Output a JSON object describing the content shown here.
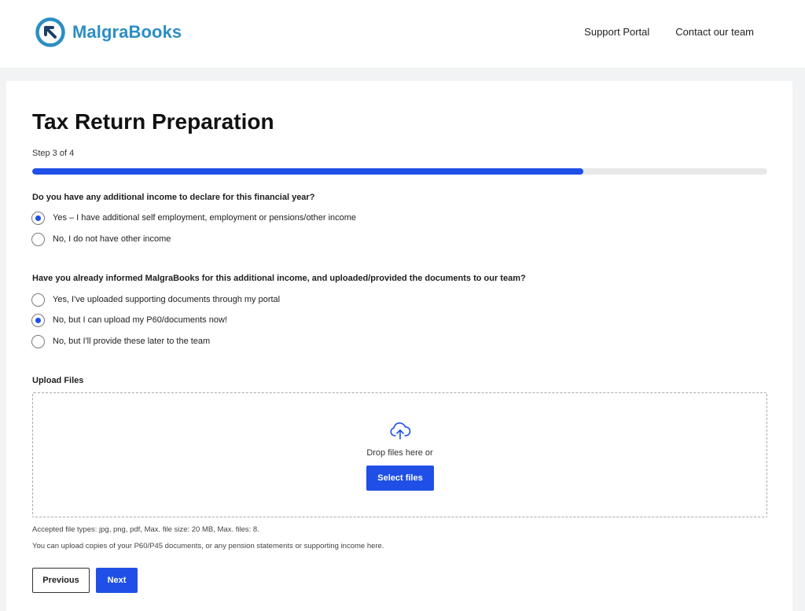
{
  "header": {
    "brand": "MalgraBooks",
    "nav": [
      "Support Portal",
      "Contact our team"
    ]
  },
  "form": {
    "title": "Tax Return Preparation",
    "step_text": "Step 3 of 4",
    "progress_fraction": 0.75,
    "q1": {
      "label": "Do you have any additional income to declare for this financial year?",
      "options": [
        {
          "label": "Yes – I have additional self employment, employment or pensions/other income",
          "checked": true
        },
        {
          "label": "No, I do not have other income",
          "checked": false
        }
      ]
    },
    "q2": {
      "label": "Have you already informed MalgraBooks for this additional income, and uploaded/provided the documents to our team?",
      "options": [
        {
          "label": "Yes, I've uploaded supporting documents through my portal",
          "checked": false
        },
        {
          "label": "No, but I can upload my P60/documents now!",
          "checked": true
        },
        {
          "label": "No, but I'll provide these later to the team",
          "checked": false
        }
      ]
    },
    "upload": {
      "label": "Upload Files",
      "drop_text": "Drop files here or",
      "select_label": "Select files",
      "accepted_text": "Accepted file types: jpg, png, pdf, Max. file size: 20 MB, Max. files: 8.",
      "help_text": "You can upload copies of your P60/P45 documents, or any pension statements or supporting income here."
    },
    "buttons": {
      "previous": "Previous",
      "next": "Next"
    }
  },
  "colors": {
    "brand": "#2b8ec4",
    "accent": "#1f4fe6"
  },
  "icons": {
    "logo": "arrow-circle-logo-icon",
    "upload": "cloud-upload-icon"
  }
}
